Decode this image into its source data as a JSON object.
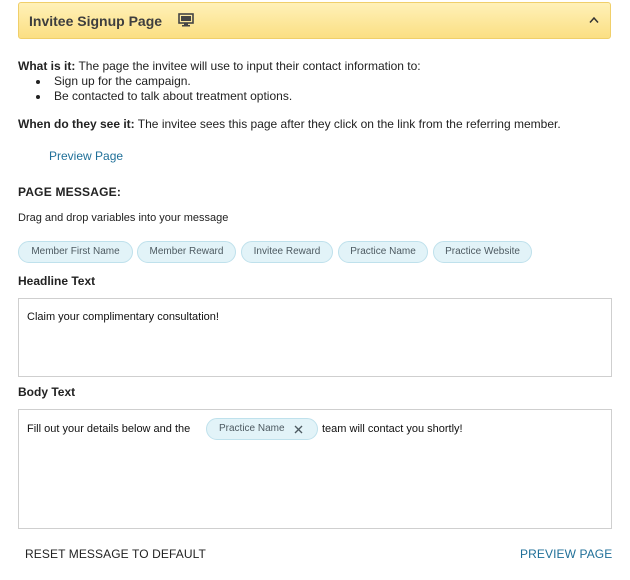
{
  "header": {
    "title": "Invitee Signup Page",
    "monitor_icon": "monitor-icon",
    "collapse_icon": "chevron-up-icon"
  },
  "info": {
    "what_label": "What is it:",
    "what_text": " The page the invitee will use to input their contact information to:",
    "bullets": [
      "Sign up for the campaign.",
      "Be contacted to talk about treatment options."
    ],
    "when_label": "When do they see it:",
    "when_text": " The invitee sees this page after they click on the link from the referring member.",
    "preview_link": "Preview Page"
  },
  "message": {
    "section_title": "PAGE MESSAGE:",
    "helper": "Drag and drop variables into your message",
    "variables": [
      "Member First Name",
      "Member Reward",
      "Invitee Reward",
      "Practice Name",
      "Practice Website"
    ]
  },
  "headline": {
    "label": "Headline Text",
    "value": "Claim your complimentary consultation!"
  },
  "body": {
    "label": "Body Text",
    "text_before": "Fill out your details below and the",
    "inline_variable": "Practice Name",
    "text_after": "team will contact you shortly!"
  },
  "footer": {
    "reset_label": "RESET MESSAGE TO DEFAULT",
    "preview_label": "PREVIEW PAGE"
  },
  "colors": {
    "header_bg": "#fbdf83",
    "link": "#1f6f98",
    "chip_bg": "#e2f3f8"
  }
}
